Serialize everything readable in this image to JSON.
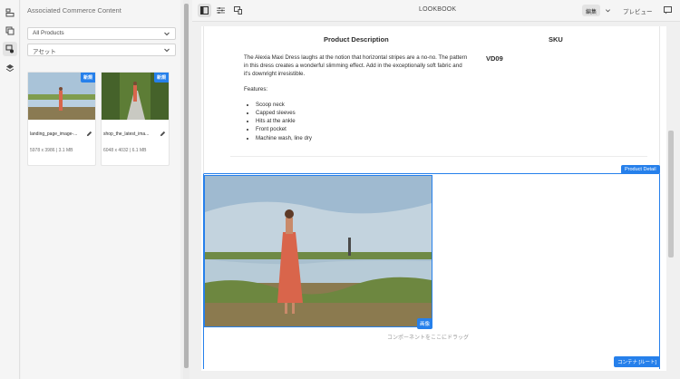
{
  "rail": {
    "items": [
      {
        "name": "rail-components-icon"
      },
      {
        "name": "rail-assets-icon"
      },
      {
        "name": "rail-commerce-icon"
      },
      {
        "name": "rail-layers-icon"
      }
    ]
  },
  "panel": {
    "title": "Associated Commerce Content",
    "filter_value": "All Products",
    "type_value": "アセット",
    "assets": [
      {
        "badge": "新規",
        "filename": "landing_page_image-...",
        "meta": "5978 x 3986 | 3.1 MB"
      },
      {
        "badge": "新規",
        "filename": "shop_the_latest_ima...",
        "meta": "6048 x 4032 | 6.1 MB"
      }
    ]
  },
  "toolbar": {
    "title": "LOOKBOOK",
    "edit_label": "編集",
    "preview_label": "プレビュー"
  },
  "product": {
    "desc_heading": "Product Description",
    "sku_heading": "SKU",
    "description": "The Alexia Maxi Dress laughs at the notion that horizontal stripes are a no-no. The pattern in this dress creates a wonderful slimming effect. Add in the exceptionally soft fabric and it's downright irresistible.",
    "features_label": "Features:",
    "features": [
      "Scoop neck",
      "Capped sleeves",
      "Hits at the ankle",
      "Front pocket",
      "Machine wash, line dry"
    ],
    "sku": "VD09"
  },
  "labels": {
    "product_detail": "Product Detail",
    "image": "画像",
    "drop_here": "コンポーネントをここにドラッグ",
    "container": "コンテナ [ルート]"
  },
  "colors": {
    "accent": "#2680eb",
    "panel_bg": "#f5f5f5"
  }
}
